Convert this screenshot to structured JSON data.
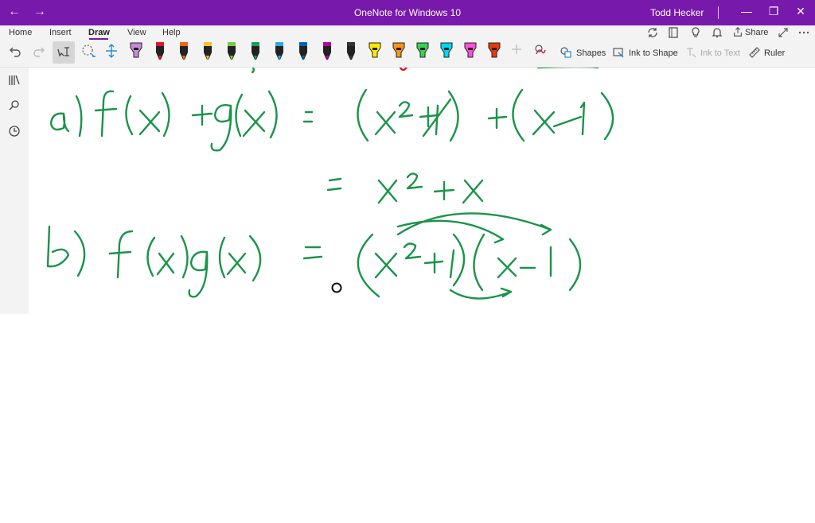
{
  "window": {
    "title": "OneNote for Windows 10",
    "user": "Todd Hecker",
    "back_glyph": "←",
    "forward_glyph": "→",
    "minimize_glyph": "—",
    "restore_glyph": "❐",
    "close_glyph": "✕"
  },
  "ribbon": {
    "tabs": [
      "Home",
      "Insert",
      "Draw",
      "View",
      "Help"
    ],
    "active_tab": "Draw",
    "share_label": "Share",
    "shapes_label": "Shapes",
    "ink_to_shape_label": "Ink to Shape",
    "ink_to_text_label": "Ink to Text",
    "ruler_label": "Ruler"
  },
  "pens": [
    {
      "type": "highlighter",
      "color": "#c98bd6"
    },
    {
      "type": "pen",
      "color": "#e81123"
    },
    {
      "type": "pen",
      "color": "#f7630c"
    },
    {
      "type": "pen",
      "color": "#fbc02d"
    },
    {
      "type": "pen",
      "color": "#7ac943"
    },
    {
      "type": "pen",
      "color": "#1a9e52"
    },
    {
      "type": "pen",
      "color": "#29abe2"
    },
    {
      "type": "pen",
      "color": "#0063b1"
    },
    {
      "type": "pen",
      "color": "#b4009e"
    },
    {
      "type": "pen",
      "color": "#333333"
    },
    {
      "type": "highlighter",
      "color": "#ffeb00"
    },
    {
      "type": "highlighter",
      "color": "#f7931e"
    },
    {
      "type": "highlighter",
      "color": "#39d353"
    },
    {
      "type": "highlighter",
      "color": "#00d7f0"
    },
    {
      "type": "highlighter",
      "color": "#ff4fd8"
    },
    {
      "type": "highlighter",
      "color": "#e8380d"
    }
  ],
  "ink": {
    "color": "#1a9449"
  }
}
